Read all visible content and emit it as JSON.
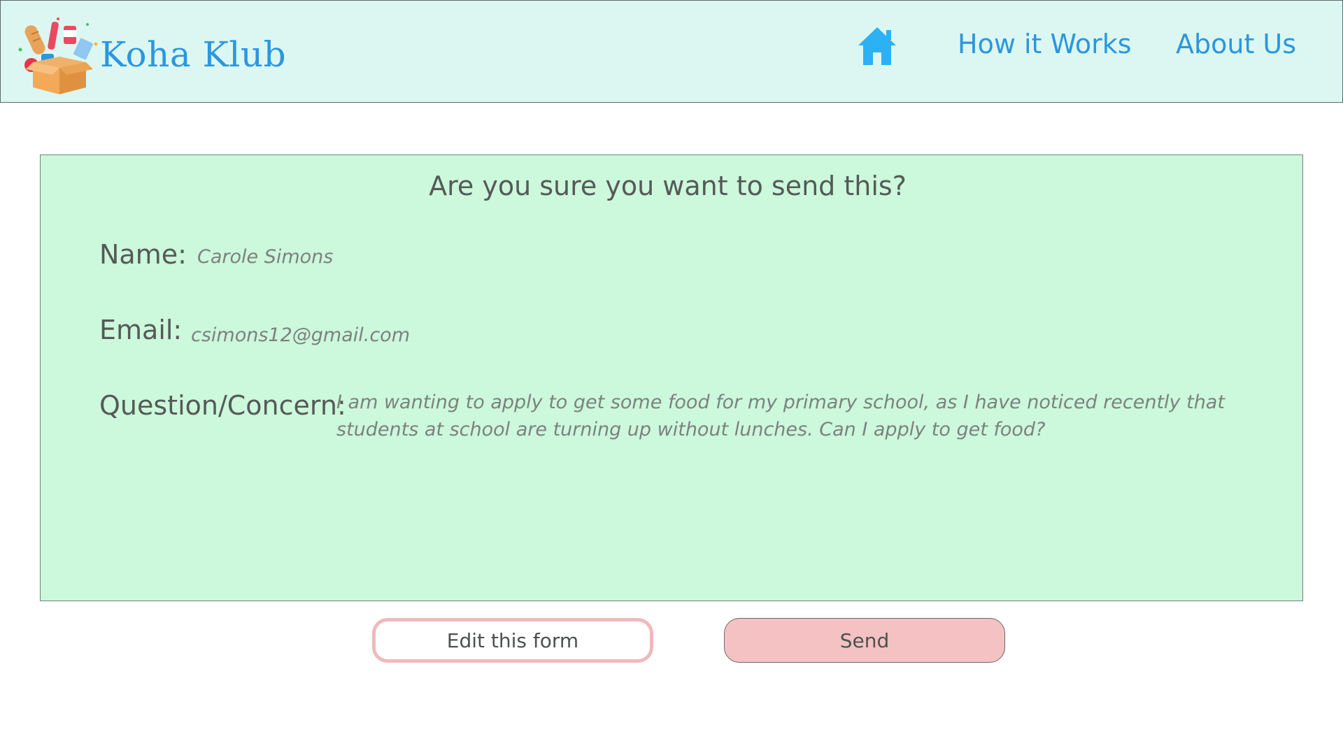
{
  "header": {
    "brand": "Koha Klub",
    "home_icon": "home-icon",
    "nav": {
      "how_it_works": "How it Works",
      "about_us": "About Us"
    }
  },
  "confirm": {
    "title": "Are you sure you want to send this?",
    "fields": {
      "name_label": "Name:",
      "name_value": "Carole Simons",
      "email_label": "Email:",
      "email_value": "csimons12@gmail.com",
      "question_label": "Question/Concern:",
      "question_value": "I am wanting to apply to get some food for my primary school, as I have noticed recently that students at school are turning up without lunches. Can I apply to get food?"
    }
  },
  "actions": {
    "edit_label": "Edit this form",
    "send_label": "Send"
  },
  "colors": {
    "header_bg": "#dcf7f2",
    "brand_blue": "#2a97e0",
    "panel_bg": "#ccf8dc",
    "edit_border": "#f1b9bb",
    "send_bg": "#f4c2c3"
  }
}
